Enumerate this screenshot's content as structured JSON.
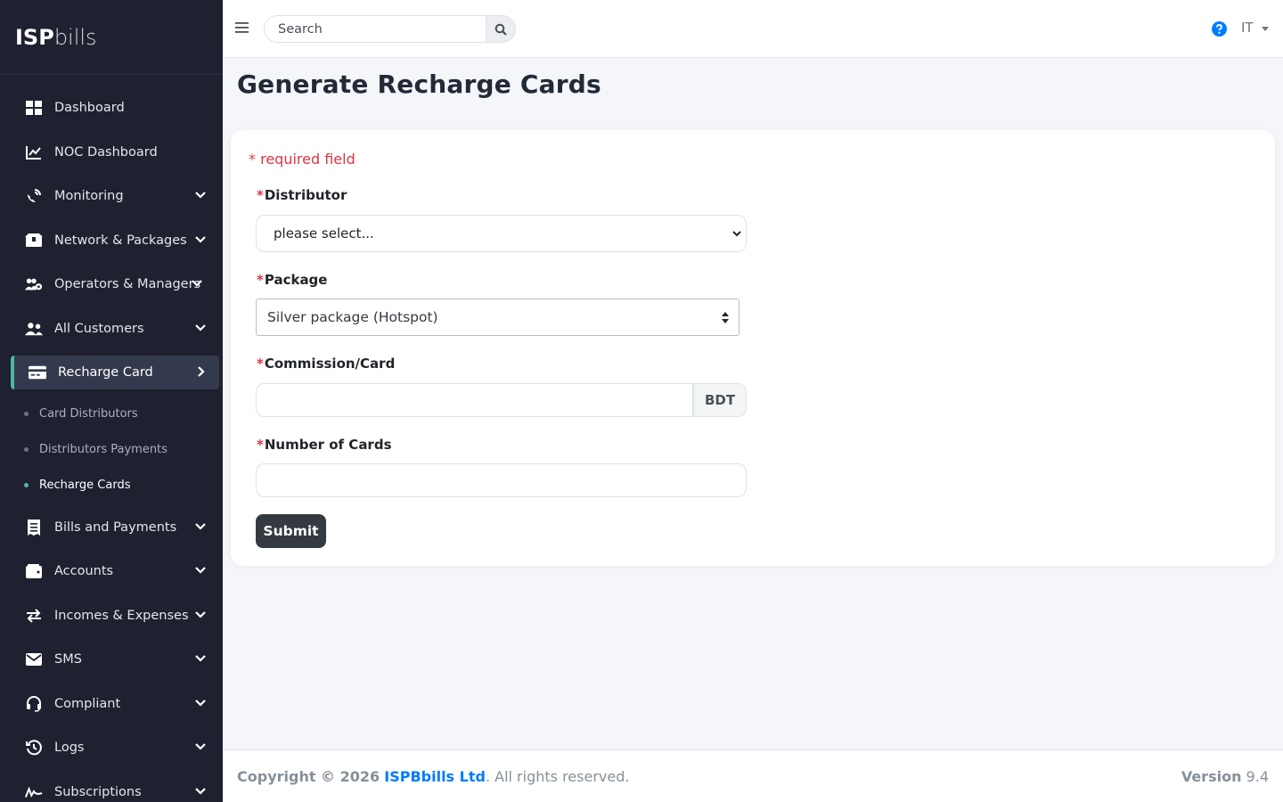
{
  "brand": {
    "bold": "ISP",
    "light": "bills"
  },
  "sidebar": {
    "items": [
      {
        "label": "Dashboard",
        "icon": "dashboard-icon"
      },
      {
        "label": "NOC Dashboard",
        "icon": "chart-line-icon"
      },
      {
        "label": "Monitoring",
        "icon": "satellite-dish-icon"
      },
      {
        "label": "Network & Packages",
        "icon": "boxes-icon"
      },
      {
        "label": "Operators & Managers",
        "icon": "users-cog-icon"
      },
      {
        "label": "All Customers",
        "icon": "user-friends-icon"
      },
      {
        "label": "Recharge Card",
        "icon": "credit-card-icon"
      },
      {
        "label": "Bills and Payments",
        "icon": "receipt-icon"
      },
      {
        "label": "Accounts",
        "icon": "wallet-icon"
      },
      {
        "label": "Incomes & Expenses",
        "icon": "exchange-icon"
      },
      {
        "label": "SMS",
        "icon": "envelope-icon"
      },
      {
        "label": "Compliant",
        "icon": "headset-icon"
      },
      {
        "label": "Logs",
        "icon": "history-icon"
      },
      {
        "label": "Subscriptions",
        "icon": "signature-icon"
      }
    ],
    "recharge_sub": [
      {
        "label": "Card Distributors"
      },
      {
        "label": "Distributors Payments"
      },
      {
        "label": "Recharge Cards"
      }
    ]
  },
  "header": {
    "search_placeholder": "Search",
    "user": "IT"
  },
  "page": {
    "title": "Generate Recharge Cards"
  },
  "form": {
    "required_note": "* required field",
    "star": "*",
    "distributor_label": "Distributor",
    "distributor_value": "please select...",
    "package_label": "Package",
    "package_value": "Silver package (Hotspot)",
    "commission_label": "Commission/Card",
    "commission_value": "",
    "commission_addon": "BDT",
    "cards_label": "Number of Cards",
    "cards_value": "",
    "submit_label": "Submit"
  },
  "footer": {
    "copyright_prefix": "Copyright © 2026",
    "company": "ISPBbills Ltd",
    "suffix": ". All rights reserved.",
    "version_label": "Version",
    "version": "9.4"
  },
  "colors": {
    "sidebar_bg": "#1f2130",
    "active_accent": "#4fb7a8",
    "required_red": "#dc3545",
    "link_blue": "#007bff",
    "button_dark": "#343a40"
  }
}
